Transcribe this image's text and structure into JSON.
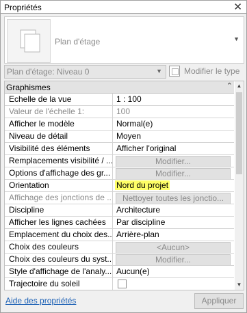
{
  "window": {
    "title": "Propriétés",
    "close_glyph": "✕"
  },
  "type_selector": {
    "name": "Plan d'étage"
  },
  "instance": {
    "selected": "Plan d'étage: Niveau 0",
    "edit_type_label": "Modifier le type"
  },
  "group": {
    "label": "Graphismes",
    "collapse_glyph": "⌃"
  },
  "rows": [
    {
      "name": "Echelle de la vue",
      "value": "1 : 100"
    },
    {
      "name": "Valeur de l'échelle    1:",
      "value": "100"
    },
    {
      "name": "Afficher le modèle",
      "value": "Normal(e)"
    },
    {
      "name": "Niveau de détail",
      "value": "Moyen"
    },
    {
      "name": "Visibilité des éléments",
      "value": "Afficher l'original"
    },
    {
      "name": "Remplacements visibilité / ...",
      "value": "Modifier..."
    },
    {
      "name": "Options d'affichage des gr...",
      "value": "Modifier..."
    },
    {
      "name": "Orientation",
      "value": "Nord du projet"
    },
    {
      "name": "Affichage des jonctions de ...",
      "value": "Nettoyer toutes les jonctio..."
    },
    {
      "name": "Discipline",
      "value": "Architecture"
    },
    {
      "name": "Afficher les lignes cachées",
      "value": "Par discipline"
    },
    {
      "name": "Emplacement du choix des...",
      "value": "Arrière-plan"
    },
    {
      "name": "Choix des couleurs",
      "value": "<Aucun>"
    },
    {
      "name": "Choix des couleurs du syst...",
      "value": "Modifier..."
    },
    {
      "name": "Style d'affichage de l'analy...",
      "value": "Aucun(e)"
    },
    {
      "name": "Trajectoire du soleil",
      "value": ""
    }
  ],
  "footer": {
    "help_link": "Aide des propriétés",
    "apply_label": "Appliquer"
  },
  "colors": {
    "highlight": "#ffff66",
    "link": "#1a5fb4"
  }
}
